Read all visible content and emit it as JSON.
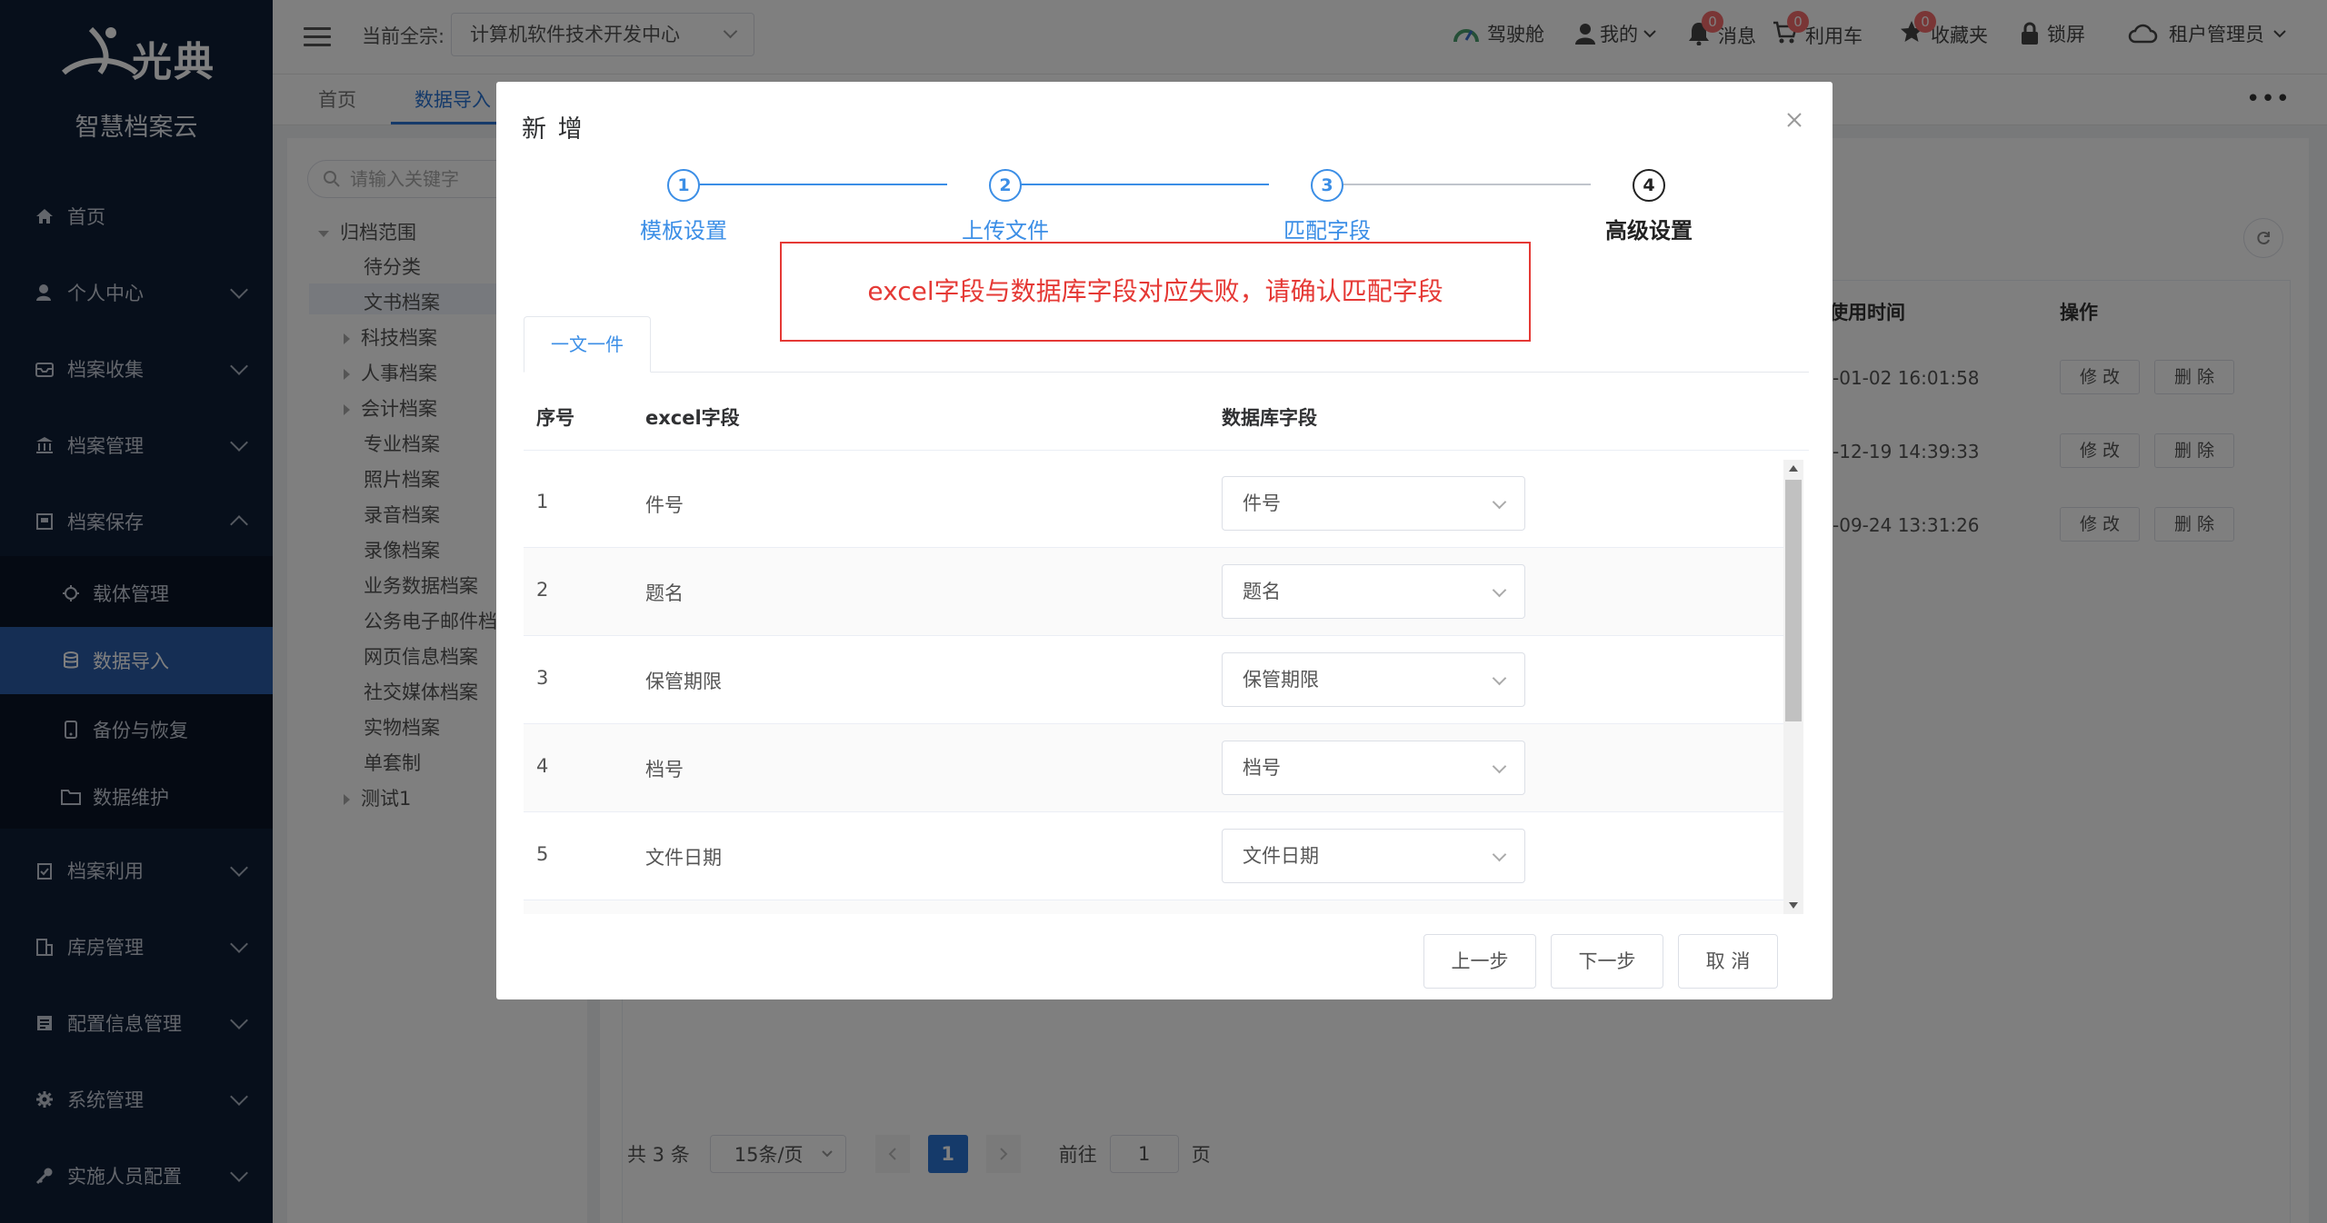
{
  "app": {
    "logo_text": "光典",
    "subtitle": "智慧档案云"
  },
  "sidebar": {
    "menu": [
      {
        "label": "首页",
        "icon": "home-icon"
      },
      {
        "label": "个人中心",
        "icon": "user-icon"
      },
      {
        "label": "档案收集",
        "icon": "inbox-icon"
      },
      {
        "label": "档案管理",
        "icon": "bank-icon"
      },
      {
        "label": "档案保存",
        "icon": "archive-icon"
      }
    ],
    "sub": [
      {
        "label": "载体管理",
        "icon": "chip-icon"
      },
      {
        "label": "数据导入",
        "icon": "database-icon"
      },
      {
        "label": "备份与恢复",
        "icon": "phone-icon"
      },
      {
        "label": "数据维护",
        "icon": "folder-icon"
      }
    ],
    "menu2": [
      {
        "label": "档案利用",
        "icon": "clipboard-icon"
      },
      {
        "label": "库房管理",
        "icon": "building-icon"
      },
      {
        "label": "配置信息管理",
        "icon": "list-icon"
      },
      {
        "label": "系统管理",
        "icon": "gear-icon"
      },
      {
        "label": "实施人员配置",
        "icon": "key-icon"
      }
    ]
  },
  "topbar": {
    "current_label": "当前全宗:",
    "current_value": "计算机软件技术开发中心",
    "cockpit": "驾驶舱",
    "mine": "我的",
    "messages": "消息",
    "messages_count": "0",
    "cart": "利用车",
    "cart_count": "0",
    "favorites": "收藏夹",
    "favorites_count": "0",
    "lock": "锁屏",
    "user": "租户管理员"
  },
  "tabs": {
    "home": "首页",
    "import": "数据导入"
  },
  "tree": {
    "search_placeholder": "请输入关键字",
    "root": "归档范围",
    "nodes": [
      "待分类",
      "文书档案",
      "科技档案",
      "人事档案",
      "会计档案",
      "专业档案",
      "照片档案",
      "录音档案",
      "录像档案",
      "业务数据档案",
      "公务电子邮件档",
      "网页信息档案",
      "社交媒体档案",
      "实物档案",
      "单套制",
      "测试1"
    ]
  },
  "table": {
    "col_time": "使用时间",
    "col_ops": "操作",
    "rows": [
      {
        "time": "-01-02 16:01:58"
      },
      {
        "time": "-12-19 14:39:33"
      },
      {
        "time": "-09-24 13:31:26"
      }
    ],
    "edit": "修 改",
    "delete": "删 除"
  },
  "pager": {
    "total": "共 3 条",
    "size": "15条/页",
    "page": "1",
    "goto": "前往",
    "goto_val": "1",
    "page_unit": "页"
  },
  "dialog": {
    "title": "新 增",
    "steps": [
      {
        "num": "1",
        "label": "模板设置"
      },
      {
        "num": "2",
        "label": "上传文件"
      },
      {
        "num": "3",
        "label": "匹配字段"
      },
      {
        "num": "4",
        "label": "高级设置"
      }
    ],
    "error": "excel字段与数据库字段对应失败，请确认匹配字段",
    "tab": "一文一件",
    "headers": {
      "idx": "序号",
      "excel": "excel字段",
      "db": "数据库字段"
    },
    "rows": [
      {
        "idx": "1",
        "excel": "件号",
        "db": "件号"
      },
      {
        "idx": "2",
        "excel": "题名",
        "db": "题名"
      },
      {
        "idx": "3",
        "excel": "保管期限",
        "db": "保管期限"
      },
      {
        "idx": "4",
        "excel": "档号",
        "db": "档号"
      },
      {
        "idx": "5",
        "excel": "文件日期",
        "db": "文件日期"
      }
    ],
    "btn_prev": "上一步",
    "btn_next": "下一步",
    "btn_cancel": "取 消"
  },
  "colors": {
    "sidebar": "#0f1e36",
    "accent": "#2a74d5",
    "error": "#e53935",
    "badge": "#f56c6c"
  }
}
